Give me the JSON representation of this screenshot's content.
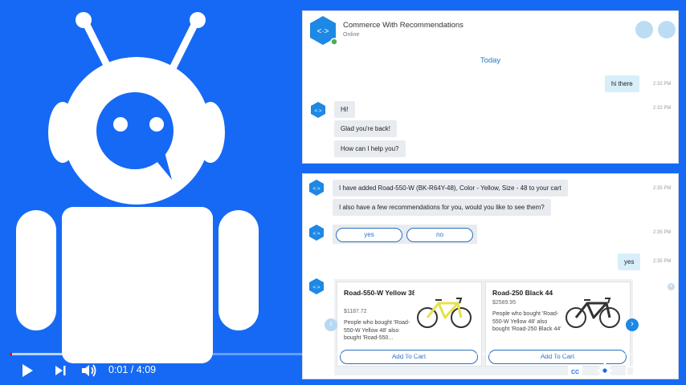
{
  "video": {
    "time_current": "0:01",
    "time_separator": " / ",
    "time_total": "4:09",
    "progress_fraction": 0.004,
    "buffered_fraction": 0.24
  },
  "chat_top": {
    "title": "Commerce With Recommendations",
    "status": "Online",
    "date_divider": "Today",
    "messages": [
      {
        "text": "hi there",
        "time": "2:32 PM",
        "from": "user"
      },
      {
        "text": "Hi!",
        "time": "2:32 PM",
        "from": "bot"
      },
      {
        "text": "Glad you're back!",
        "from": "bot"
      },
      {
        "text": "How can I help you?",
        "from": "bot"
      }
    ]
  },
  "chat_bottom": {
    "msg1": "I have added Road-550-W (BK-R64Y-48), Color - Yellow, Size - 48 to your cart",
    "msg1_time": "2:35 PM",
    "msg2": "I also have a few recommendations for you, would you like to see them?",
    "options_time": "2:35 PM",
    "option_yes": "yes",
    "option_no": "no",
    "user_reply": "yes",
    "user_reply_time": "2:35 PM",
    "cards": [
      {
        "title": "Road-550-W Yellow 38",
        "price": "$1187.72",
        "desc": "People who bought 'Road-550-W Yellow 48' also bought 'Road-550...",
        "button": "Add To Cart",
        "bike_color": "#e8e14a"
      },
      {
        "title": "Road-250 Black 44",
        "price": "$2589.95",
        "desc": "People who bought 'Road-550-W Yellow 48' also bought 'Road-250 Black 44'",
        "button": "Add To Cart",
        "bike_color": "#333333"
      }
    ]
  },
  "colors": {
    "background": "#1669f4",
    "accent": "#2a6ec0",
    "avatar": "#1e88e5"
  },
  "icons": [
    "robot-logo",
    "bot-avatar-icon",
    "video-call-icon",
    "phone-icon",
    "play-icon",
    "next-icon",
    "volume-icon",
    "subtitles-icon",
    "settings-icon",
    "theater-icon",
    "fullscreen-icon",
    "carousel-prev-icon",
    "carousel-next-icon"
  ]
}
